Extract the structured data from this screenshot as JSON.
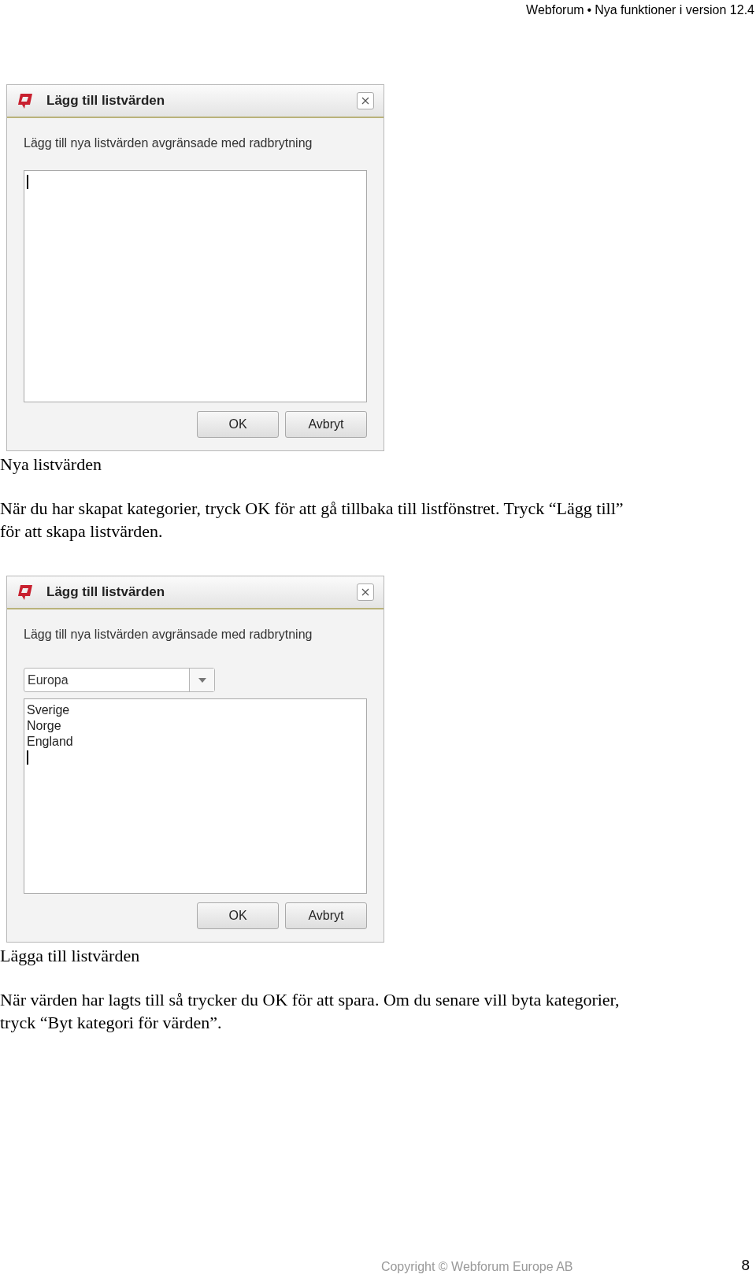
{
  "header": {
    "brand": "Webforum",
    "separator": "•",
    "title": "Nya funktioner i version 12.4"
  },
  "sections": [
    {
      "dialog": {
        "title": "Lägg till listvärden",
        "instruction": "Lägg till nya listvärden avgränsade med radbrytning",
        "buttons": [
          "OK",
          "Avbryt"
        ]
      },
      "caption": "Nya listvärden",
      "paragraph": "När du har skapat kategorier, tryck OK för att gå tillbaka till listfönstret. Tryck “Lägg till” för att skapa listvärden."
    },
    {
      "dialog": {
        "title": "Lägg till listvärden",
        "instruction": "Lägg till nya listvärden avgränsade med radbrytning",
        "dropdown": {
          "value": "Europa"
        },
        "lines": [
          "Sverige",
          "Norge",
          "England"
        ],
        "buttons": [
          "OK",
          "Avbryt"
        ]
      },
      "caption": "Lägga till listvärden",
      "paragraph": "När värden har lagts till så trycker du OK för att spara. Om du senare vill byta kategorier, tryck “Byt kategori för värden”."
    }
  ],
  "footer": {
    "copyright": "Copyright © Webforum Europe AB",
    "page": "8"
  }
}
